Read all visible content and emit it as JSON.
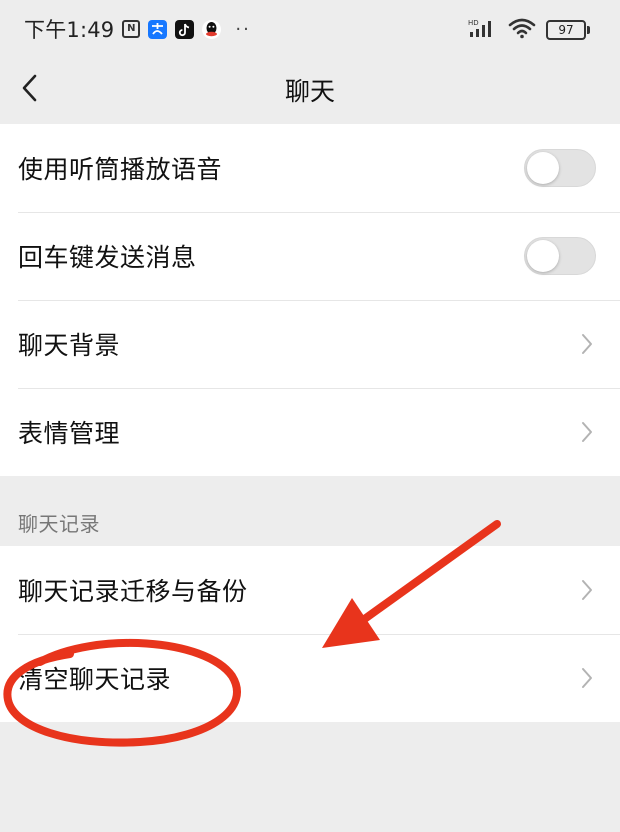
{
  "status_bar": {
    "time": "下午1:49",
    "nfc_icon": "N",
    "battery": "97"
  },
  "nav": {
    "title": "聊天"
  },
  "settings": {
    "group1": [
      {
        "label": "使用听筒播放语音",
        "control": "toggle",
        "on": false
      },
      {
        "label": "回车键发送消息",
        "control": "toggle",
        "on": false
      },
      {
        "label": "聊天背景",
        "control": "chevron"
      },
      {
        "label": "表情管理",
        "control": "chevron"
      }
    ],
    "section_header": "聊天记录",
    "group2": [
      {
        "label": "聊天记录迁移与备份",
        "control": "chevron"
      },
      {
        "label": "清空聊天记录",
        "control": "chevron"
      }
    ]
  },
  "colors": {
    "page_bg": "#ededed",
    "row_bg": "#ffffff",
    "annotation_red": "#e8341c"
  },
  "icons": {
    "back": "chevron-left-icon",
    "row_arrow": "chevron-right-icon"
  }
}
